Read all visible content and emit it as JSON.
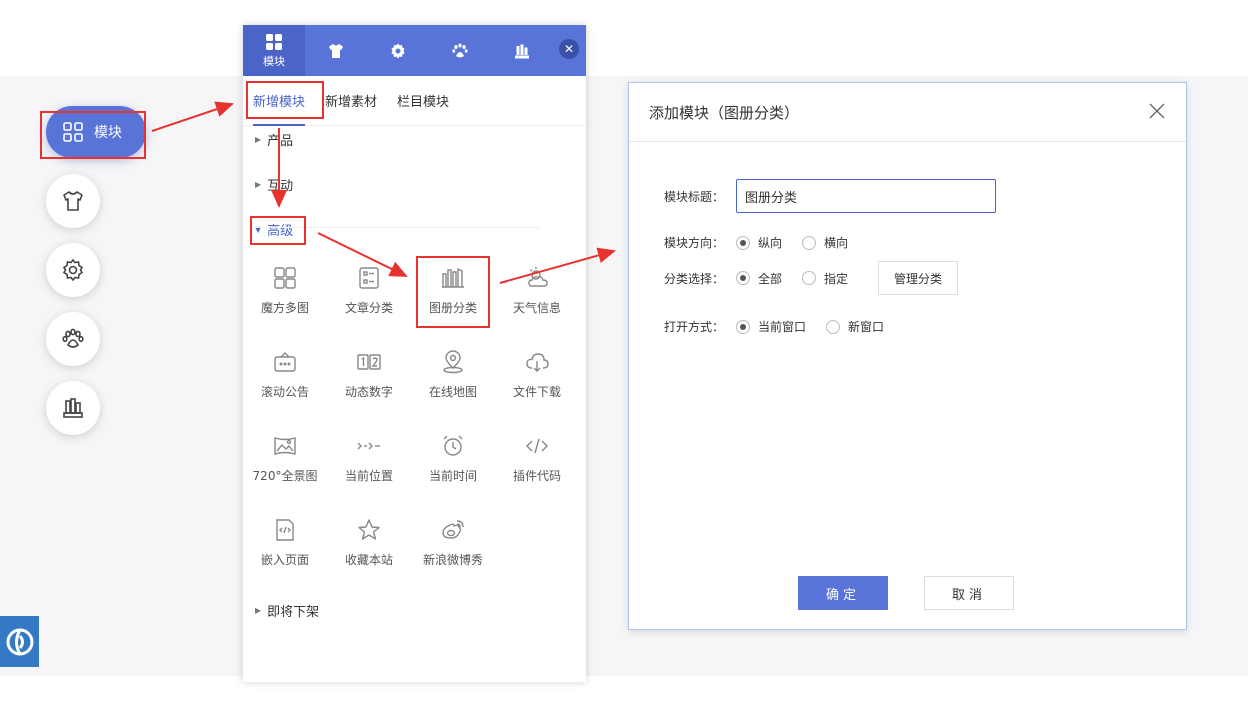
{
  "toolbar": {
    "main_label": "模块",
    "buttons": [
      "shirt-icon",
      "gear-icon",
      "paw-icon",
      "bookshelf-icon"
    ]
  },
  "panel": {
    "top_tabs": [
      {
        "label": "模块",
        "icon": "grid-icon"
      },
      {
        "icon": "shirt-icon"
      },
      {
        "icon": "gear-icon"
      },
      {
        "icon": "paw-icon"
      },
      {
        "icon": "bookshelf-icon"
      }
    ],
    "subtabs": [
      "新增模块",
      "新增素材",
      "栏目模块"
    ],
    "categories": {
      "products": "产品",
      "interact": "互动",
      "advanced": "高级",
      "retiring": "即将下架"
    },
    "modules": [
      {
        "label": "魔方多图",
        "icon": "cube-grid-icon"
      },
      {
        "label": "文章分类",
        "icon": "article-list-icon"
      },
      {
        "label": "图册分类",
        "icon": "album-icon"
      },
      {
        "label": "天气信息",
        "icon": "weather-icon"
      },
      {
        "label": "滚动公告",
        "icon": "notice-icon"
      },
      {
        "label": "动态数字",
        "icon": "number-icon"
      },
      {
        "label": "在线地图",
        "icon": "map-pin-icon"
      },
      {
        "label": "文件下载",
        "icon": "cloud-download-icon"
      },
      {
        "label": "720°全景图",
        "icon": "panorama-icon"
      },
      {
        "label": "当前位置",
        "icon": "breadcrumb-icon"
      },
      {
        "label": "当前时间",
        "icon": "alarm-clock-icon"
      },
      {
        "label": "插件代码",
        "icon": "code-icon"
      },
      {
        "label": "嵌入页面",
        "icon": "embed-page-icon"
      },
      {
        "label": "收藏本站",
        "icon": "star-icon"
      },
      {
        "label": "新浪微博秀",
        "icon": "weibo-icon"
      }
    ]
  },
  "dialog": {
    "title": "添加模块（图册分类）",
    "title_label": "模块标题：",
    "title_value": "图册分类",
    "direction_label": "模块方向：",
    "direction_options": [
      "纵向",
      "横向"
    ],
    "direction_selected": 0,
    "category_label": "分类选择：",
    "category_options": [
      "全部",
      "指定"
    ],
    "category_selected": 0,
    "manage_label": "管理分类",
    "open_label": "打开方式：",
    "open_options": [
      "当前窗口",
      "新窗口"
    ],
    "open_selected": 0,
    "ok_label": "确定",
    "cancel_label": "取消"
  },
  "colors": {
    "accent": "#5874d8",
    "annotation": "#e8322f"
  }
}
